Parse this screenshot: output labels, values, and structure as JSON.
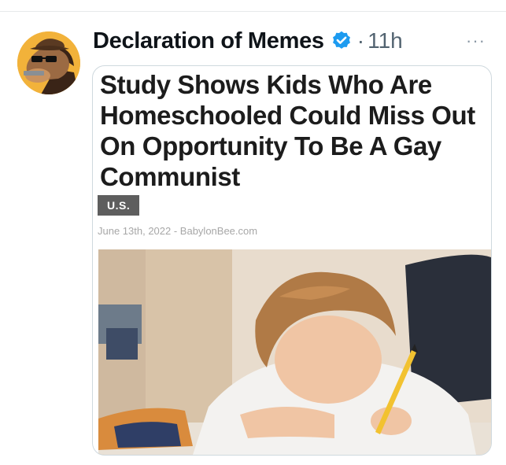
{
  "tweet": {
    "display_name": "Declaration of Memes",
    "separator": "·",
    "timestamp": "11h",
    "more_label": "···",
    "verified_icon": "verified-badge-icon",
    "accent_color": "#1d9bf0"
  },
  "card": {
    "headline": "Study Shows Kids Who Are Homeschooled Could Miss Out On Opportunity To Be A Gay Communist",
    "section_tag": "U.S.",
    "byline": "June 13th, 2022 - BabylonBee.com"
  }
}
